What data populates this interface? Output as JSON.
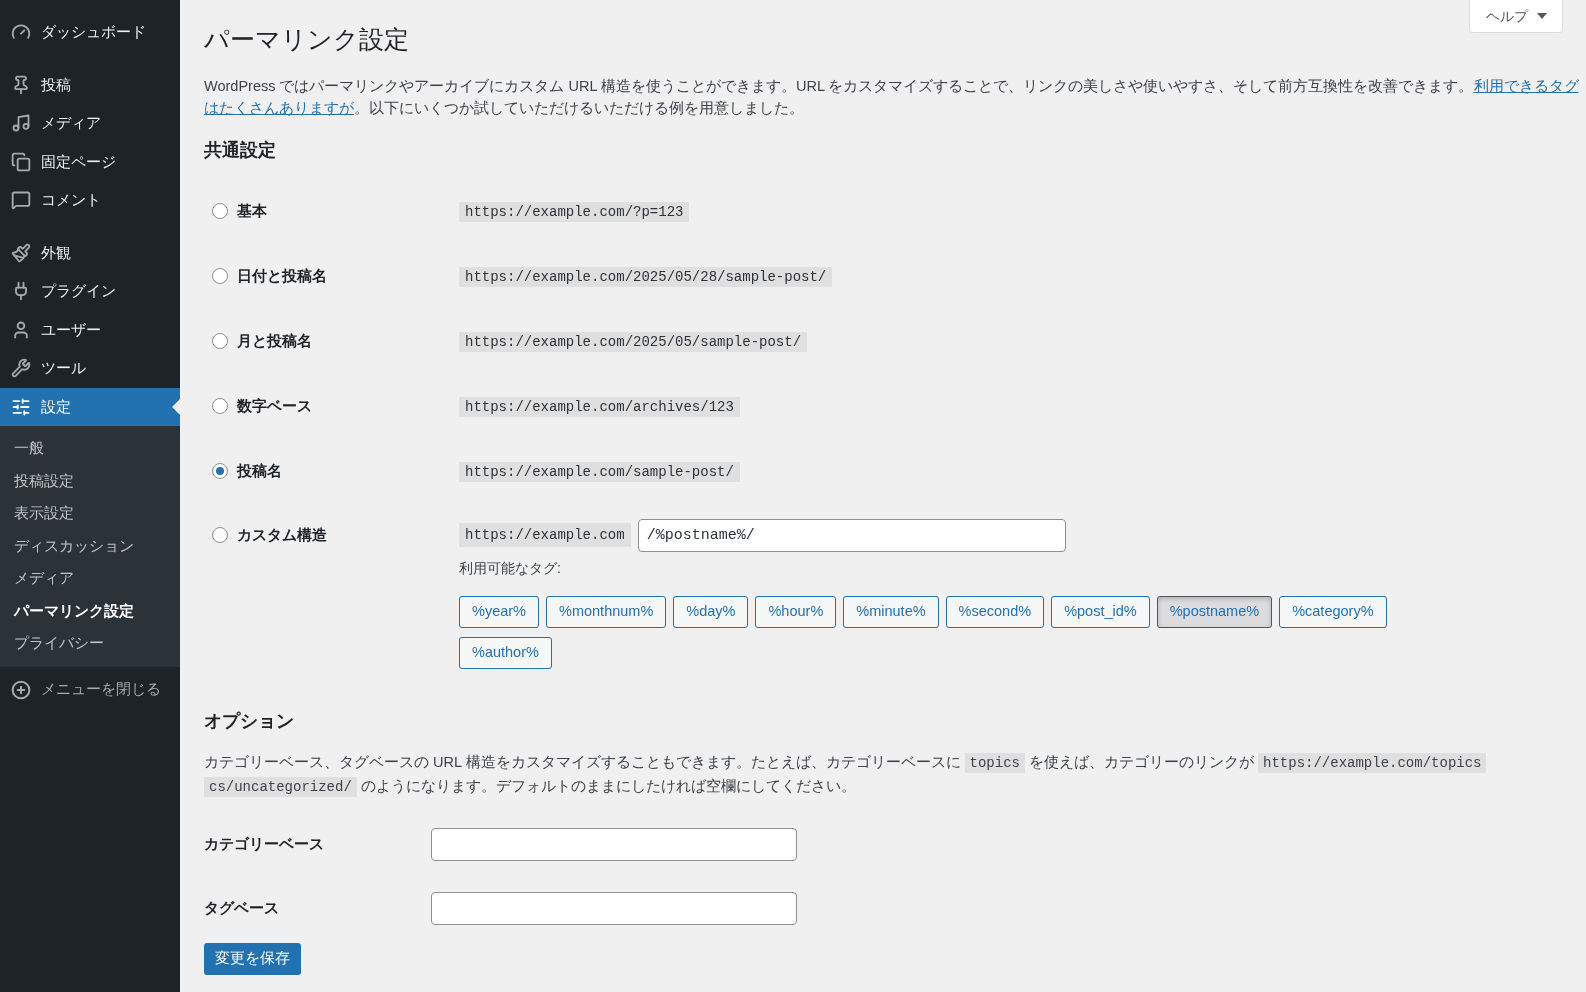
{
  "sidebar": {
    "groups": [
      {
        "items": [
          {
            "label": "ダッシュボード",
            "selected": false
          }
        ]
      },
      {
        "items": [
          {
            "label": "投稿",
            "selected": false
          },
          {
            "label": "メディア",
            "selected": false
          },
          {
            "label": "固定ページ",
            "selected": false
          },
          {
            "label": "コメント",
            "selected": false
          }
        ]
      },
      {
        "items": [
          {
            "label": "外観",
            "selected": false
          },
          {
            "label": "プラグイン",
            "selected": false
          },
          {
            "label": "ユーザー",
            "selected": false
          },
          {
            "label": "ツール",
            "selected": false
          },
          {
            "label": "設定",
            "selected": true,
            "children": [
              {
                "label": "一般",
                "selected": false
              },
              {
                "label": "投稿設定",
                "selected": false
              },
              {
                "label": "表示設定",
                "selected": false
              },
              {
                "label": "ディスカッション",
                "selected": false
              },
              {
                "label": "メディア",
                "selected": false
              },
              {
                "label": "パーマリンク設定",
                "selected": true
              },
              {
                "label": "プライバシー",
                "selected": false
              }
            ]
          }
        ]
      }
    ],
    "collapse_label": "メニューを閉じる"
  },
  "help": {
    "label": "ヘルプ"
  },
  "page": {
    "title": "パーマリンク設定",
    "intro": {
      "lines": [
        [
          {
            "kind": "text",
            "text": "WordPress ではパーマリンクやアーカイブにカスタム URL 構造を使うことができます。URL をカスタマイズすることで、リンクの美しさや使いやすさ、そして前方互換性を改善できます。"
          },
          {
            "kind": "link",
            "text": "利用できるタグ"
          }
        ],
        [
          {
            "kind": "link",
            "text": "はたくさんありますが"
          },
          {
            "kind": "text",
            "text": "。以下にいくつか試していただけるいただける例を用意しました。"
          }
        ]
      ]
    }
  },
  "common_settings": {
    "heading": "共通設定",
    "options": [
      {
        "kind": "preset",
        "label": "基本",
        "example": "https://example.com/?p=123",
        "selected": false
      },
      {
        "kind": "preset",
        "label": "日付と投稿名",
        "example": "https://example.com/2025/05/28/sample-post/",
        "selected": false
      },
      {
        "kind": "preset",
        "label": "月と投稿名",
        "example": "https://example.com/2025/05/sample-post/",
        "selected": false
      },
      {
        "kind": "preset",
        "label": "数字ベース",
        "example": "https://example.com/archives/123",
        "selected": false
      },
      {
        "kind": "preset",
        "label": "投稿名",
        "example": "https://example.com/sample-post/",
        "selected": true
      },
      {
        "kind": "custom",
        "label": "カスタム構造",
        "prefix": "https://example.com",
        "value": "/%postname%/",
        "selected": false
      }
    ],
    "available_tags_label": "利用可能なタグ:",
    "tags": [
      {
        "label": "%year%",
        "selected": false
      },
      {
        "label": "%monthnum%",
        "selected": false
      },
      {
        "label": "%day%",
        "selected": false
      },
      {
        "label": "%hour%",
        "selected": false
      },
      {
        "label": "%minute%",
        "selected": false
      },
      {
        "label": "%second%",
        "selected": false
      },
      {
        "label": "%post_id%",
        "selected": false
      },
      {
        "label": "%postname%",
        "selected": true
      },
      {
        "label": "%category%",
        "selected": false
      },
      {
        "label": "%author%",
        "selected": false
      }
    ]
  },
  "optional": {
    "heading": "オプション",
    "description": {
      "lines": [
        [
          {
            "kind": "text",
            "text": "カテゴリーベース、タグベースの URL 構造をカスタマイズすることもできます。たとえば、カテゴリーベースに "
          },
          {
            "kind": "code",
            "text": "topics"
          },
          {
            "kind": "text",
            "text": " を使えば、カテゴリーのリンクが "
          },
          {
            "kind": "code",
            "text": "https://example.com/topics"
          }
        ],
        [
          {
            "kind": "code",
            "text": "cs/uncategorized/"
          },
          {
            "kind": "text",
            "text": " のようになります。デフォルトのままにしたければ空欄にしてください。"
          }
        ]
      ]
    },
    "fields": [
      {
        "label": "カテゴリーベース"
      },
      {
        "label": "タグベース"
      }
    ]
  },
  "save_button": {
    "label": "変更を保存"
  }
}
